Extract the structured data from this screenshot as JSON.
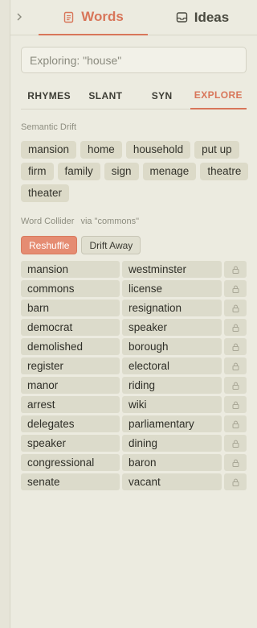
{
  "nav": {
    "collapse_icon": "chevron-right-icon",
    "tabs": [
      {
        "label": "Words",
        "icon": "document-icon",
        "active": true
      },
      {
        "label": "Ideas",
        "icon": "inbox-icon",
        "active": false
      }
    ]
  },
  "search": {
    "value": "Exploring: \"house\""
  },
  "mode_tabs": [
    {
      "label": "RHYMES",
      "active": false
    },
    {
      "label": "SLANT",
      "active": false
    },
    {
      "label": "SYN",
      "active": false
    },
    {
      "label": "EXPLORE",
      "active": true
    }
  ],
  "semantic_drift": {
    "label": "Semantic Drift",
    "chips": [
      "mansion",
      "home",
      "household",
      "put up",
      "firm",
      "family",
      "sign",
      "menage",
      "theatre",
      "theater"
    ]
  },
  "word_collider": {
    "label": "Word Collider",
    "via": "via \"commons\"",
    "reshuffle_label": "Reshuffle",
    "drift_away_label": "Drift Away",
    "rows": [
      {
        "left": "mansion",
        "right": "westminster"
      },
      {
        "left": "commons",
        "right": "license"
      },
      {
        "left": "barn",
        "right": "resignation"
      },
      {
        "left": "democrat",
        "right": "speaker"
      },
      {
        "left": "demolished",
        "right": "borough"
      },
      {
        "left": "register",
        "right": "electoral"
      },
      {
        "left": "manor",
        "right": "riding"
      },
      {
        "left": "arrest",
        "right": "wiki"
      },
      {
        "left": "delegates",
        "right": "parliamentary"
      },
      {
        "left": "speaker",
        "right": "dining"
      },
      {
        "left": "congressional",
        "right": "baron"
      },
      {
        "left": "senate",
        "right": "vacant"
      }
    ]
  },
  "colors": {
    "accent": "#d8765a",
    "background": "#ecebe0",
    "chip": "#dcdac8"
  }
}
